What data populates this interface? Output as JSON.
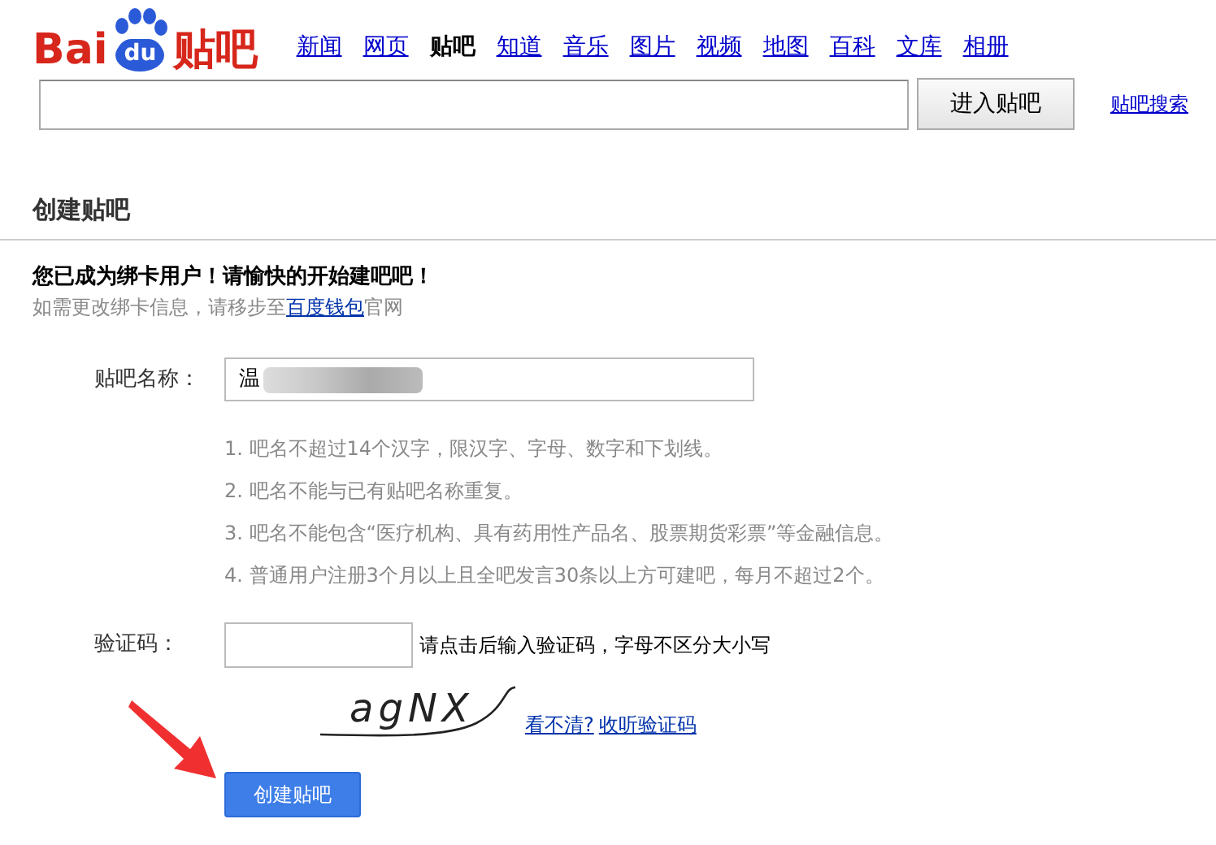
{
  "logo": {
    "left": "Bai",
    "paw": "du",
    "right": "贴吧"
  },
  "nav": [
    {
      "label": "新闻",
      "selected": false
    },
    {
      "label": "网页",
      "selected": false
    },
    {
      "label": "贴吧",
      "selected": true
    },
    {
      "label": "知道",
      "selected": false
    },
    {
      "label": "音乐",
      "selected": false
    },
    {
      "label": "图片",
      "selected": false
    },
    {
      "label": "视频",
      "selected": false
    },
    {
      "label": "地图",
      "selected": false
    },
    {
      "label": "百科",
      "selected": false
    },
    {
      "label": "文库",
      "selected": false
    },
    {
      "label": "相册",
      "selected": false
    }
  ],
  "search": {
    "button": "进入贴吧",
    "link": "贴吧搜索"
  },
  "section_title": "创建贴吧",
  "notice": {
    "headline": "您已成为绑卡用户！请愉快的开始建吧吧！",
    "before": "如需更改绑卡信息，请移步至",
    "link": "百度钱包",
    "after": "官网"
  },
  "name_field": {
    "label": "贴吧名称：",
    "value": "温"
  },
  "rules": [
    "1. 吧名不超过14个汉字，限汉字、字母、数字和下划线。",
    "2. 吧名不能与已有贴吧名称重复。",
    "3. 吧名不能包含“医疗机构、具有药用性产品名、股票期货彩票”等金融信息。",
    "4. 普通用户注册3个月以上且全吧发言30条以上方可建吧，每月不超过2个。"
  ],
  "captcha": {
    "label": "验证码：",
    "hint": "请点击后输入验证码，字母不区分大小写",
    "code": "agNX",
    "links": [
      "看不清?",
      "收听验证码"
    ]
  },
  "submit": "创建贴吧"
}
